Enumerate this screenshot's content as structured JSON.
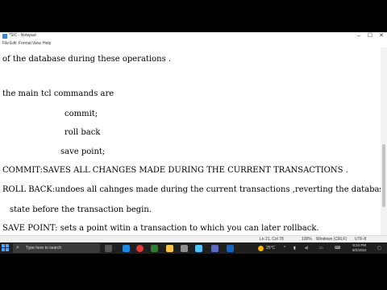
{
  "window": {
    "title": "*SIC - Notepad",
    "controls": {
      "minimize": "–",
      "maximize": "☐",
      "close": "✕"
    }
  },
  "menu": [
    "File",
    "Edit",
    "Format",
    "View",
    "Help"
  ],
  "editor": {
    "lines": [
      "of the database during these operations .",
      "the main tcl commands are",
      "commit;",
      "roll back",
      "save point;",
      "COMMIT:SAVES ALL CHANGES MADE DURING THE CURRENT TRANSACTIONS .",
      "ROLL BACK:undoes all cahnges made during the current transactions ,reverting the database to its",
      "state before the transaction begin.",
      "SAVE POINT: sets a point witin a transaction to which you can later rollback."
    ]
  },
  "status": {
    "position": "Ln 21, Col 78",
    "zoom": "100%",
    "line_endings": "Windows (CRLF)",
    "encoding": "UTF-8"
  },
  "taskbar": {
    "search_placeholder": "Type here to search",
    "temperature": "25°C",
    "time": "9:24 PM",
    "date": "9/2/2024",
    "icons": [
      "start-icon",
      "search-icon",
      "task-view-icon",
      "file-explorer-icon",
      "chrome-icon",
      "edge-icon",
      "folder-icon",
      "store-icon",
      "settings-icon",
      "notepad-icon",
      "word-icon",
      "teams-icon",
      "weather-icon"
    ]
  }
}
